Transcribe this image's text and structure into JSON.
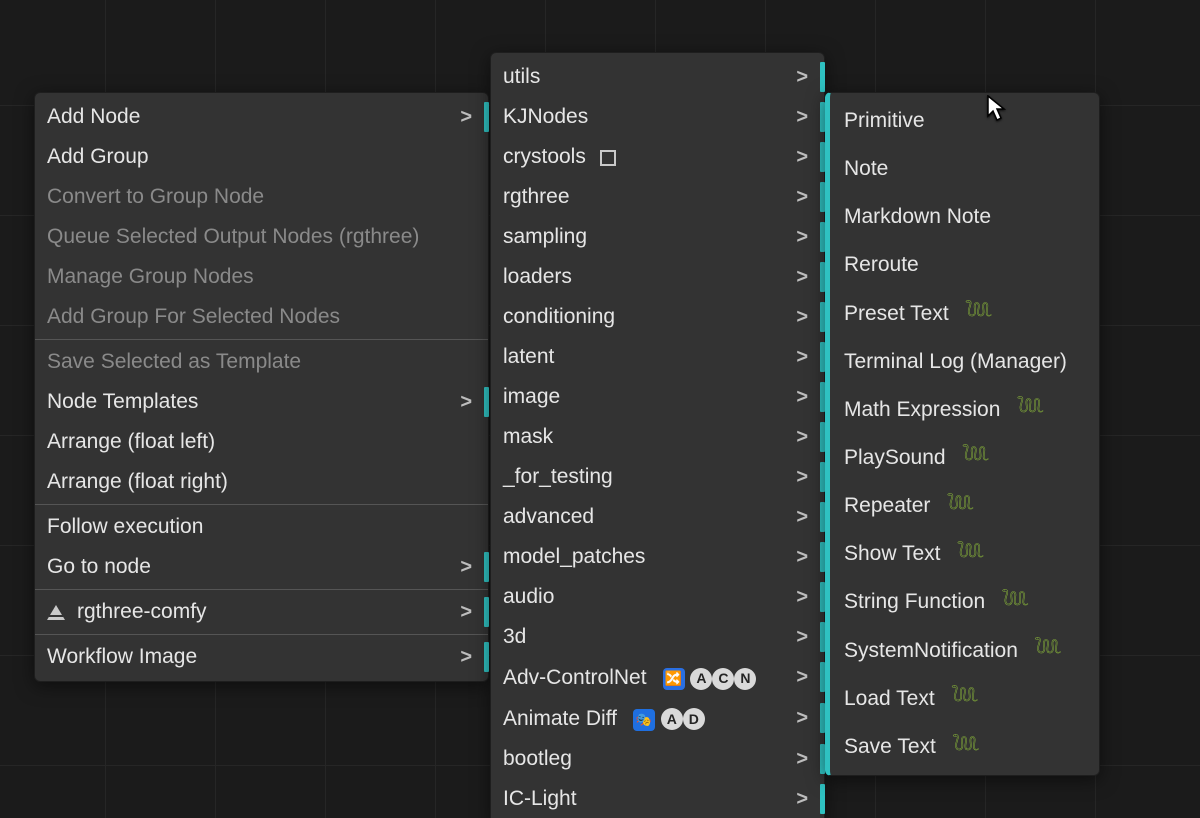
{
  "menus": {
    "main": {
      "groups": [
        [
          {
            "key": "add-node",
            "label": "Add Node",
            "submenu": true,
            "enabled": true
          },
          {
            "key": "add-group",
            "label": "Add Group",
            "submenu": false,
            "enabled": true
          },
          {
            "key": "convert-group",
            "label": "Convert to Group Node",
            "submenu": false,
            "enabled": false
          },
          {
            "key": "queue-rgthree",
            "label": "Queue Selected Output Nodes (rgthree)",
            "submenu": false,
            "enabled": false
          },
          {
            "key": "manage-groups",
            "label": "Manage Group Nodes",
            "submenu": false,
            "enabled": false
          },
          {
            "key": "addgroup-sel",
            "label": "Add Group For Selected Nodes",
            "submenu": false,
            "enabled": false
          }
        ],
        [
          {
            "key": "save-template",
            "label": "Save Selected as Template",
            "submenu": false,
            "enabled": false
          },
          {
            "key": "node-templates",
            "label": "Node Templates",
            "submenu": true,
            "enabled": true
          },
          {
            "key": "arrange-left",
            "label": "Arrange (float left)",
            "submenu": false,
            "enabled": true
          },
          {
            "key": "arrange-right",
            "label": "Arrange (float right)",
            "submenu": false,
            "enabled": true
          }
        ],
        [
          {
            "key": "follow-exec",
            "label": "Follow execution",
            "submenu": false,
            "enabled": true
          },
          {
            "key": "goto-node",
            "label": "Go to node",
            "submenu": true,
            "enabled": true
          }
        ],
        [
          {
            "key": "rgthree-comfy",
            "label": "rgthree-comfy",
            "submenu": true,
            "enabled": true,
            "icon": "triangle"
          }
        ],
        [
          {
            "key": "workflow-image",
            "label": "Workflow Image",
            "submenu": true,
            "enabled": true
          }
        ]
      ]
    },
    "categories": {
      "items": [
        {
          "key": "utils",
          "label": "utils",
          "submenu": true
        },
        {
          "key": "kjnodes",
          "label": "KJNodes",
          "submenu": true
        },
        {
          "key": "crystools",
          "label": "crystools",
          "submenu": true,
          "suffix": "box"
        },
        {
          "key": "rgthree",
          "label": "rgthree",
          "submenu": true
        },
        {
          "key": "sampling",
          "label": "sampling",
          "submenu": true
        },
        {
          "key": "loaders",
          "label": "loaders",
          "submenu": true
        },
        {
          "key": "conditioning",
          "label": "conditioning",
          "submenu": true
        },
        {
          "key": "latent",
          "label": "latent",
          "submenu": true
        },
        {
          "key": "image",
          "label": "image",
          "submenu": true
        },
        {
          "key": "mask",
          "label": "mask",
          "submenu": true
        },
        {
          "key": "for-testing",
          "label": "_for_testing",
          "submenu": true
        },
        {
          "key": "advanced",
          "label": "advanced",
          "submenu": true
        },
        {
          "key": "model-patches",
          "label": "model_patches",
          "submenu": true
        },
        {
          "key": "audio",
          "label": "audio",
          "submenu": true
        },
        {
          "key": "3d",
          "label": "3d",
          "submenu": true
        },
        {
          "key": "adv-controlnet",
          "label": "Adv-ControlNet",
          "submenu": true,
          "suffix": "acn"
        },
        {
          "key": "animate-diff",
          "label": "Animate Diff",
          "submenu": true,
          "suffix": "ad"
        },
        {
          "key": "bootleg",
          "label": "bootleg",
          "submenu": true
        },
        {
          "key": "ic-light",
          "label": "IC-Light",
          "submenu": true
        }
      ]
    },
    "utils": {
      "items": [
        {
          "key": "primitive",
          "label": "Primitive"
        },
        {
          "key": "note",
          "label": "Note"
        },
        {
          "key": "markdown-note",
          "label": "Markdown Note"
        },
        {
          "key": "reroute",
          "label": "Reroute"
        },
        {
          "key": "preset-text",
          "label": "Preset Text",
          "snake": true
        },
        {
          "key": "terminal-log",
          "label": "Terminal Log (Manager)"
        },
        {
          "key": "math-expression",
          "label": "Math Expression",
          "snake": true
        },
        {
          "key": "playsound",
          "label": "PlaySound",
          "snake": true
        },
        {
          "key": "repeater",
          "label": "Repeater",
          "snake": true
        },
        {
          "key": "show-text",
          "label": "Show Text",
          "snake": true
        },
        {
          "key": "string-function",
          "label": "String Function",
          "snake": true
        },
        {
          "key": "system-notification",
          "label": "SystemNotification",
          "snake": true
        },
        {
          "key": "load-text",
          "label": "Load Text",
          "snake": true
        },
        {
          "key": "save-text",
          "label": "Save Text",
          "snake": true
        }
      ]
    }
  },
  "colors": {
    "accent": "#2fc1c1",
    "snake": "#8fbf3a"
  }
}
